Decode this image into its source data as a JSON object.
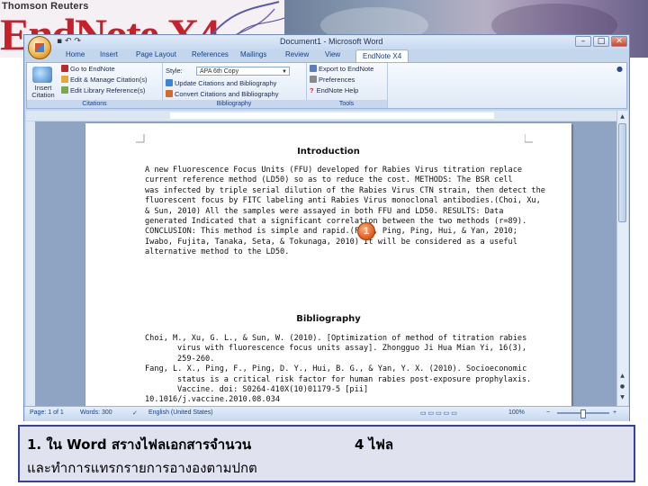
{
  "banner": {
    "company": "Thomson Reuters",
    "logo_text": "EndNote X4"
  },
  "window": {
    "title": "Document1 - Microsoft Word",
    "controls": {
      "minimize": "–",
      "maximize": "□",
      "close": "✕"
    },
    "qat_icons": [
      "save-icon",
      "undo-icon",
      "redo-icon"
    ]
  },
  "ribbon": {
    "tabs": [
      "Home",
      "Insert",
      "Page Layout",
      "References",
      "Mailings",
      "Review",
      "View",
      "EndNote X4"
    ],
    "active_tab": "EndNote X4",
    "citations": {
      "label": "Citations",
      "insert_label": "Insert Citation",
      "go_to": "Go to EndNote",
      "edit_manage": "Edit & Manage Citation(s)",
      "edit_library": "Edit Library Reference(s)"
    },
    "bibliography": {
      "label": "Bibliography",
      "style_label": "Style:",
      "style_value": "APA 6th Copy",
      "update": "Update Citations and Bibliography",
      "convert": "Convert Citations and Bibliography"
    },
    "tools": {
      "label": "Tools",
      "export": "Export to EndNote",
      "preferences": "Preferences",
      "help": "EndNote Help"
    }
  },
  "document": {
    "intro_heading": "Introduction",
    "intro_lines": [
      "A new Fluorescence Focus Units (FFU) developed for Rabies Virus titration replace",
      "current reference method (LD50) so as to reduce the cost. METHODS: The BSR cell",
      "was infected by triple serial dilution of the Rabies Virus CTN strain, then detect the",
      "fluorescent focus by FITC labeling anti Rabies Virus monoclonal antibodies.(Choi, Xu,",
      "& Sun, 2010) All the samples were assayed in both FFU and LD50. RESULTS: Data",
      "generated Indicated that a significant correlation between the two methods (r=89).",
      "CONCLUSION: This method is simple and rapid.(Fang, Ping, Ping, Hui, & Yan, 2010;",
      "Iwabo, Fujita, Tanaka, Seta, & Tokunaga, 2010) It will be considered as a useful",
      "alternative method to the LD50."
    ],
    "marker": "1",
    "bib_heading": "Bibliography",
    "bib_lines": [
      {
        "text": "Choi, M., Xu, G. L., & Sun, W. (2010). [Optimization of method of titration rabies",
        "indent": false
      },
      {
        "text": "virus with fluorescence focus units assay]. Zhongguo Ji Hua Mian Yi, 16(3),",
        "indent": true
      },
      {
        "text": "259-260.",
        "indent": true
      },
      {
        "text": "Fang, L. X., Ping, F., Ping, D. Y., Hui, B. G., & Yan, Y. X. (2010). Socioeconomic",
        "indent": false
      },
      {
        "text": "status is a critical risk factor for human rabies post-exposure prophylaxis.",
        "indent": true
      },
      {
        "text": "Vaccine. doi: S0264-410X(10)01179-5 [pii]",
        "indent": true
      },
      {
        "text": "10.1016/j.vaccine.2010.08.034",
        "indent": false
      }
    ]
  },
  "status_bar": {
    "page": "Page: 1 of 1",
    "words": "Words: 300",
    "language": "English (United States)",
    "zoom": "100%",
    "zoom_fraction": 0.5
  },
  "caption": {
    "line1": "1. ใน Word สรางไฟลเอกสารจำนวน",
    "count": "4 ไฟล",
    "line2": "และทำการแทรกรายการอางองตามปกต"
  }
}
